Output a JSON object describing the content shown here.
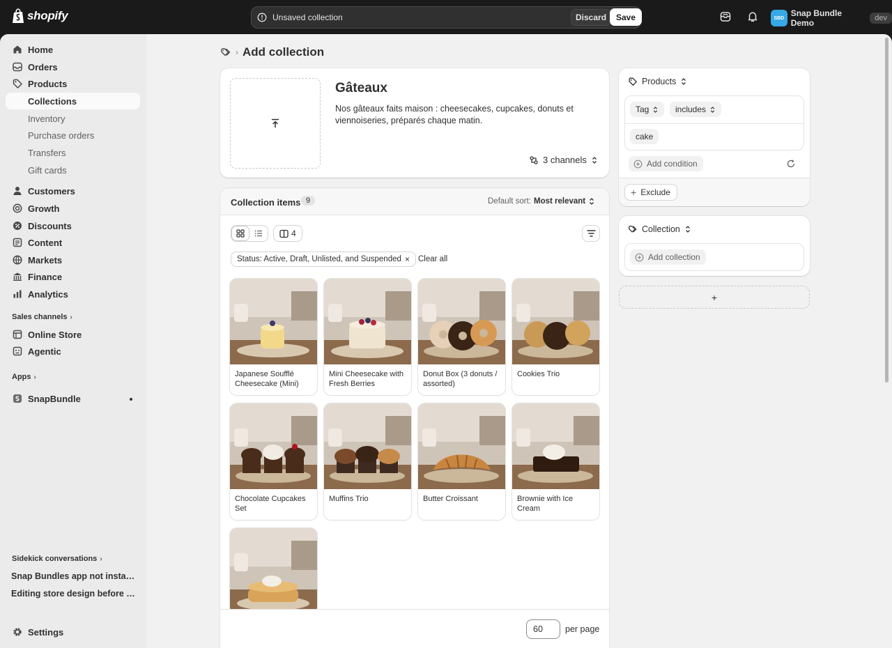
{
  "brand": {
    "wordmark": "shopify"
  },
  "topbar": {
    "unsaved_message": "Unsaved collection",
    "discard_label": "Discard",
    "save_label": "Save",
    "store_initials": "SBD",
    "store_name": "Snap Bundle Demo",
    "env_badge": "dev"
  },
  "sidebar": {
    "main_items": [
      {
        "label": "Home",
        "icon": "home-icon"
      },
      {
        "label": "Orders",
        "icon": "inbox-icon"
      },
      {
        "label": "Products",
        "icon": "tag-icon"
      }
    ],
    "product_sub": [
      "Collections",
      "Inventory",
      "Purchase orders",
      "Transfers",
      "Gift cards"
    ],
    "more_items": [
      {
        "label": "Customers",
        "icon": "person-icon"
      },
      {
        "label": "Growth",
        "icon": "target-icon"
      },
      {
        "label": "Discounts",
        "icon": "discount-icon"
      },
      {
        "label": "Content",
        "icon": "content-icon"
      },
      {
        "label": "Markets",
        "icon": "globe-icon"
      },
      {
        "label": "Finance",
        "icon": "bank-icon"
      },
      {
        "label": "Analytics",
        "icon": "chart-icon"
      }
    ],
    "sales_channels_title": "Sales channels",
    "sales_channels": [
      {
        "label": "Online Store",
        "icon": "store-icon"
      },
      {
        "label": "Agentic",
        "icon": "agent-icon"
      }
    ],
    "apps_title": "Apps",
    "apps": [
      {
        "label": "SnapBundle",
        "icon": "app-icon"
      }
    ],
    "sidekick_title": "Sidekick conversations",
    "sidekick_items": [
      "Snap Bundles app not installed",
      "Editing store design before lau..."
    ],
    "settings_label": "Settings"
  },
  "page": {
    "title": "Add collection"
  },
  "collection": {
    "title": "Gâteaux",
    "description": "Nos gâteaux faits maison : cheesecakes, cupcakes, donuts et viennoiseries, préparés chaque matin.",
    "channels": "3 channels"
  },
  "items": {
    "title": "Collection items",
    "count": "9",
    "sort_prefix": "Default sort:",
    "sort_value": "Most relevant",
    "columns_count": "4",
    "filter_chip": "Status: Active, Draft, Unlisted, and Suspended",
    "clear_all": "Clear all",
    "products": [
      {
        "name": "Japanese Soufflé Cheesecake (Mini)",
        "kind": "souffle"
      },
      {
        "name": "Mini Cheesecake with Fresh Berries",
        "kind": "cheesecake"
      },
      {
        "name": "Donut Box (3 donuts / assorted)",
        "kind": "donut"
      },
      {
        "name": "Cookies Trio",
        "kind": "cookie"
      },
      {
        "name": "Chocolate Cupcakes Set",
        "kind": "cupcake"
      },
      {
        "name": "Muffins Trio",
        "kind": "muffin"
      },
      {
        "name": "Butter Croissant",
        "kind": "croissant"
      },
      {
        "name": "Brownie with Ice Cream",
        "kind": "brownie"
      },
      {
        "name": "",
        "kind": "pancake"
      }
    ],
    "per_page_value": "60",
    "per_page_label": "per page"
  },
  "rules": {
    "products_title": "Products",
    "field": "Tag",
    "operator": "includes",
    "value": "cake",
    "add_condition": "Add condition",
    "exclude": "Exclude",
    "collection_title": "Collection",
    "add_collection": "Add collection",
    "add_group_symbol": "+"
  }
}
